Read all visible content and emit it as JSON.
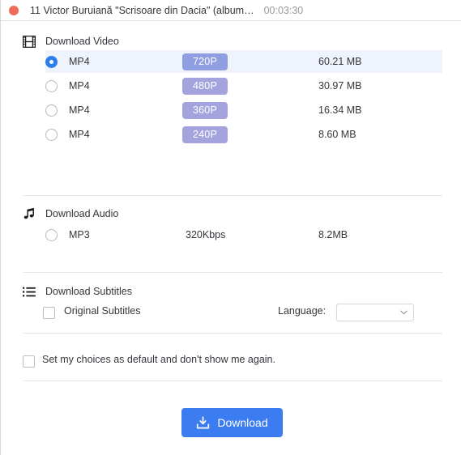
{
  "window": {
    "title": "11 Victor Buruiană \"Scrisoare din Dacia\" (album…",
    "duration": "00:03:30",
    "close_icon": "close-dot-icon"
  },
  "video_section": {
    "icon": "film-icon",
    "heading": "Download Video",
    "columns": [
      "format",
      "quality",
      "size"
    ],
    "rows": [
      {
        "format": "MP4",
        "quality": "720P",
        "size": "60.21 MB",
        "selected": true
      },
      {
        "format": "MP4",
        "quality": "480P",
        "size": "30.97 MB",
        "selected": false
      },
      {
        "format": "MP4",
        "quality": "360P",
        "size": "16.34 MB",
        "selected": false
      },
      {
        "format": "MP4",
        "quality": "240P",
        "size": "8.60 MB",
        "selected": false
      }
    ]
  },
  "audio_section": {
    "icon": "music-note-icon",
    "heading": "Download Audio",
    "row": {
      "format": "MP3",
      "bitrate": "320Kbps",
      "size": "8.2MB",
      "selected": false
    }
  },
  "subtitles_section": {
    "icon": "list-icon",
    "heading": "Download Subtitles",
    "original_label": "Original Subtitles",
    "original_checked": false,
    "language_label": "Language:",
    "language_value": "",
    "language_chevron_icon": "chevron-down-icon"
  },
  "defaults": {
    "label": "Set my choices as default and don't show me again.",
    "checked": false
  },
  "footer": {
    "download_label": "Download",
    "download_icon": "download-tray-icon"
  },
  "colors": {
    "accent_blue": "#3b7cf0",
    "radio_blue": "#2f7ef0",
    "badge_purple": "#a5a3dd",
    "badge_selected": "#8f9ee0",
    "row_highlight": "#eff3fc",
    "close_red": "#ef6a58"
  }
}
